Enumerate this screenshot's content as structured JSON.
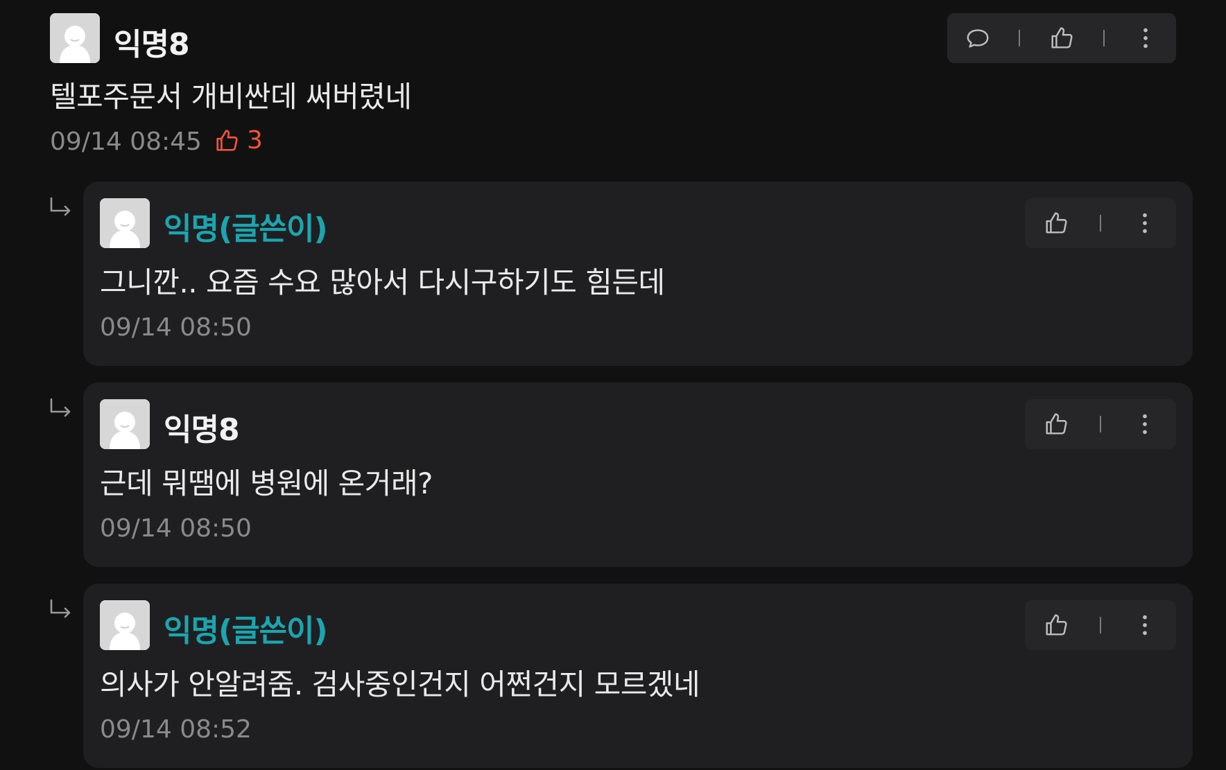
{
  "comments": [
    {
      "author": "익명8",
      "author_type": "anonymous",
      "body": "텔포주문서 개비싼데 써버렸네",
      "time": "09/14 08:45",
      "likes": "3",
      "actions": [
        "reply-icon",
        "thumbs-up-icon",
        "more-vertical-icon"
      ]
    }
  ],
  "replies": [
    {
      "author": "익명(글쓴이)",
      "author_type": "writer",
      "body": "그니깐.. 요즘 수요 많아서 다시구하기도 힘든데",
      "time": "09/14 08:50",
      "actions": [
        "thumbs-up-icon",
        "more-vertical-icon"
      ]
    },
    {
      "author": "익명8",
      "author_type": "anonymous",
      "body": "근데 뭐땜에 병원에 온거래?",
      "time": "09/14 08:50",
      "actions": [
        "thumbs-up-icon",
        "more-vertical-icon"
      ]
    },
    {
      "author": "익명(글쓴이)",
      "author_type": "writer",
      "body": "의사가 안알려줌. 검사중인건지 어쩐건지 모르겠네",
      "time": "09/14 08:52",
      "actions": [
        "thumbs-up-icon",
        "more-vertical-icon"
      ]
    }
  ],
  "colors": {
    "background": "#111112",
    "card": "#1f1f21",
    "toolbar": "#262628",
    "writer_name": "#1aa6b0",
    "like_accent": "#f0553a",
    "timestamp": "#8a8a8a"
  }
}
